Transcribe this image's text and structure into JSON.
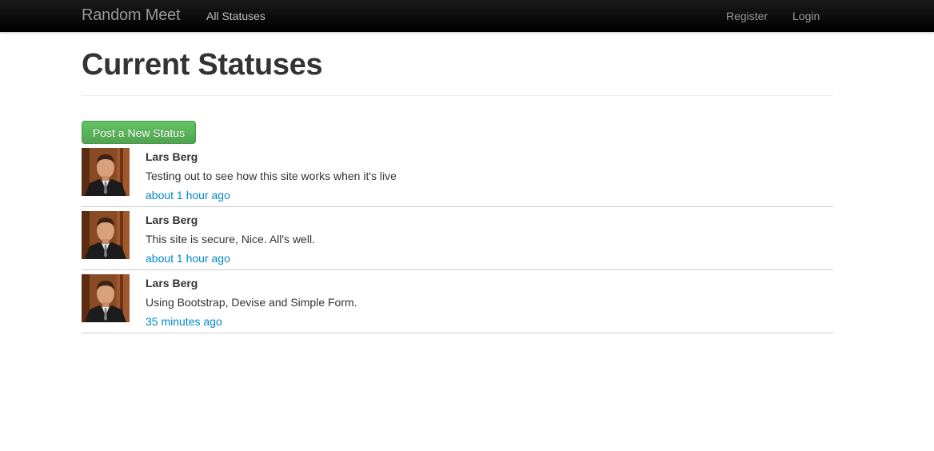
{
  "navbar": {
    "brand": "Random Meet",
    "links": [
      "All Statuses"
    ],
    "right_links": [
      "Register",
      "Login"
    ]
  },
  "page": {
    "title": "Current Statuses",
    "new_status_button": "Post a New Status"
  },
  "statuses": [
    {
      "name": "Lars Berg",
      "content": "Testing out to see how this site works when it's live",
      "time": "about 1 hour ago"
    },
    {
      "name": "Lars Berg",
      "content": "This site is secure, Nice. All's well.",
      "time": "about 1 hour ago"
    },
    {
      "name": "Lars Berg",
      "content": "Using Bootstrap, Devise and Simple Form.",
      "time": "35 minutes ago"
    }
  ],
  "colors": {
    "navbar": "#000000",
    "link": "#0088cc",
    "button": "#5bb75b"
  }
}
